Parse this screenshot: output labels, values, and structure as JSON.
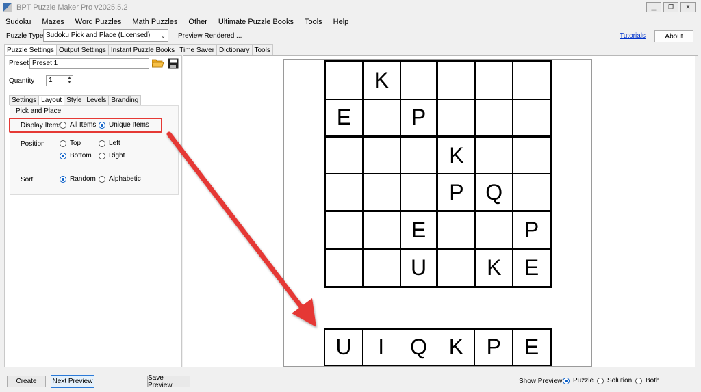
{
  "window": {
    "title": "BPT Puzzle Maker Pro v2025.5.2",
    "controls": [
      "▁",
      "❐",
      "✕"
    ]
  },
  "menu": [
    "Sudoku",
    "Mazes",
    "Word Puzzles",
    "Math Puzzles",
    "Other",
    "Ultimate Puzzle Books",
    "Tools",
    "Help"
  ],
  "toolbar": {
    "puzzle_type_label": "Puzzle Type",
    "puzzle_type_value": "Sudoku Pick and Place (Licensed)",
    "status": "Preview Rendered ...",
    "tutorials_link": "Tutorials",
    "about_button": "About"
  },
  "main_tabs": [
    "Puzzle Settings",
    "Output Settings",
    "Instant Puzzle Books",
    "Time Saver",
    "Dictionary",
    "Tools"
  ],
  "settings": {
    "preset_label": "Preset",
    "preset_value": "Preset 1",
    "quantity_label": "Quantity",
    "quantity_value": "1",
    "sub_tabs": [
      "Settings",
      "Layout",
      "Style",
      "Levels",
      "Branding"
    ],
    "group_title": "Pick and Place",
    "display_items": {
      "label": "Display Items",
      "options": [
        "All Items",
        "Unique Items"
      ],
      "selected": "Unique Items"
    },
    "position": {
      "label": "Position",
      "options": [
        "Top",
        "Left",
        "Bottom",
        "Right"
      ],
      "selected": "Bottom"
    },
    "sort": {
      "label": "Sort",
      "options": [
        "Random",
        "Alphabetic"
      ],
      "selected": "Random"
    }
  },
  "puzzle": {
    "grid": [
      [
        "",
        "K",
        "",
        "",
        "",
        ""
      ],
      [
        "E",
        "",
        "P",
        "",
        "",
        ""
      ],
      [
        "",
        "",
        "",
        "K",
        "",
        ""
      ],
      [
        "",
        "",
        "",
        "P",
        "Q",
        ""
      ],
      [
        "",
        "",
        "E",
        "",
        "",
        "P"
      ],
      [
        "",
        "",
        "U",
        "",
        "K",
        "E"
      ]
    ],
    "item_bank": [
      "U",
      "I",
      "Q",
      "K",
      "P",
      "E"
    ]
  },
  "footer": {
    "create_button": "Create",
    "next_preview_button": "Next Preview",
    "save_preview_button": "Save Preview",
    "show_preview_label": "Show Preview:",
    "show_preview_options": [
      "Puzzle",
      "Solution",
      "Both"
    ],
    "show_preview_selected": "Puzzle"
  },
  "colors": {
    "highlight_red": "#e53935",
    "radio_blue": "#0a5fc8",
    "link_blue": "#0033cc"
  }
}
